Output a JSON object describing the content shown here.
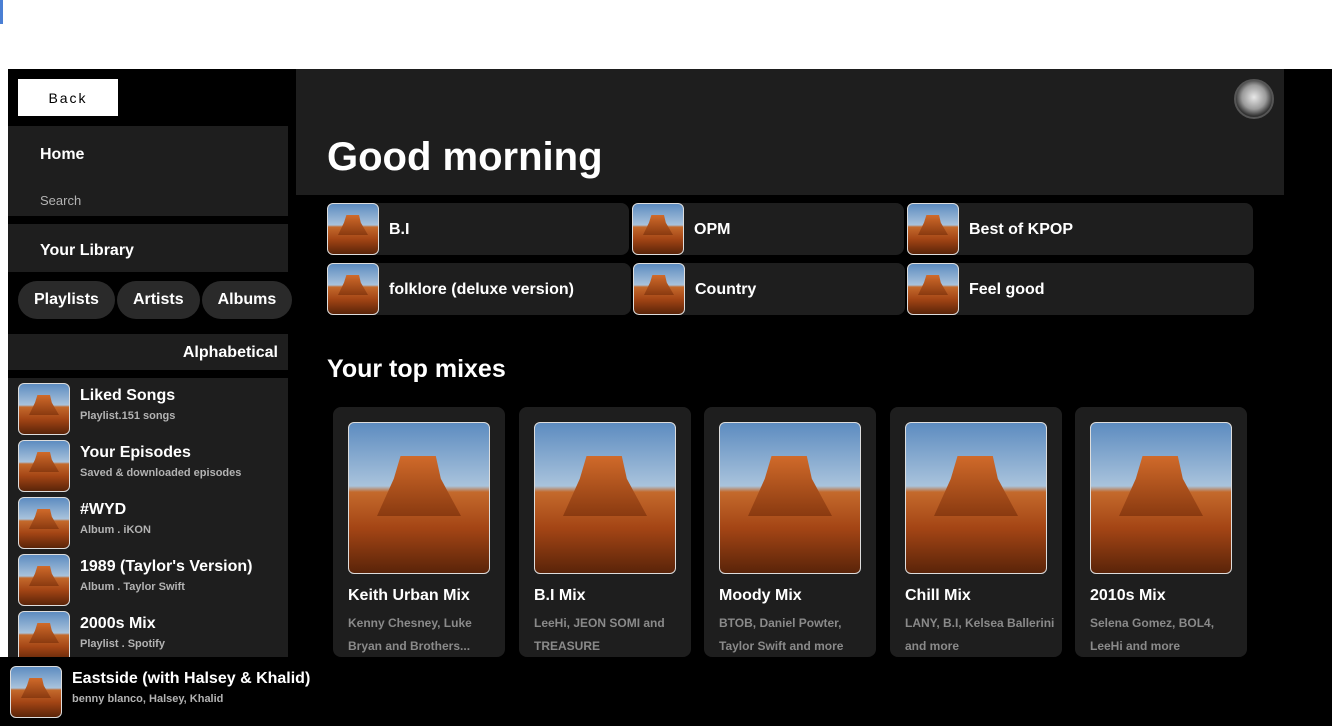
{
  "nav": {
    "back_label": "Back",
    "home_label": "Home",
    "search_label": "Search"
  },
  "library": {
    "title": "Your Library",
    "filters": [
      "Playlists",
      "Artists",
      "Albums"
    ],
    "sort_label": "Alphabetical",
    "items": [
      {
        "title": "Liked Songs",
        "subtitle": "Playlist.151 songs"
      },
      {
        "title": "Your Episodes",
        "subtitle": "Saved & downloaded episodes"
      },
      {
        "title": "#WYD",
        "subtitle": "Album . iKON"
      },
      {
        "title": "1989 (Taylor's Version)",
        "subtitle": "Album . Taylor Swift"
      },
      {
        "title": "2000s Mix",
        "subtitle": "Playlist . Spotify"
      }
    ]
  },
  "main": {
    "greeting": "Good morning",
    "quick_picks": [
      "B.I",
      "OPM",
      "Best of KPOP",
      "folklore (deluxe version)",
      "Country",
      "Feel good"
    ],
    "section_title": "Your top mixes",
    "mixes": [
      {
        "title": "Keith Urban Mix",
        "desc": "Kenny Chesney, Luke Bryan and Brothers..."
      },
      {
        "title": "B.I Mix",
        "desc": "LeeHi, JEON SOMI and TREASURE"
      },
      {
        "title": "Moody Mix",
        "desc": "BTOB, Daniel Powter, Taylor Swift and more"
      },
      {
        "title": "Chill Mix",
        "desc": "LANY, B.I, Kelsea Ballerini and more"
      },
      {
        "title": "2010s Mix",
        "desc": "Selena Gomez, BOL4, LeeHi and more"
      }
    ]
  },
  "now_playing": {
    "title": "Eastside (with Halsey & Khalid)",
    "artist": "benny blanco, Halsey, Khalid"
  },
  "colors": {
    "background": "#000000",
    "panel": "#1e1e1e",
    "text": "#ffffff",
    "muted": "#b3b3b3"
  }
}
